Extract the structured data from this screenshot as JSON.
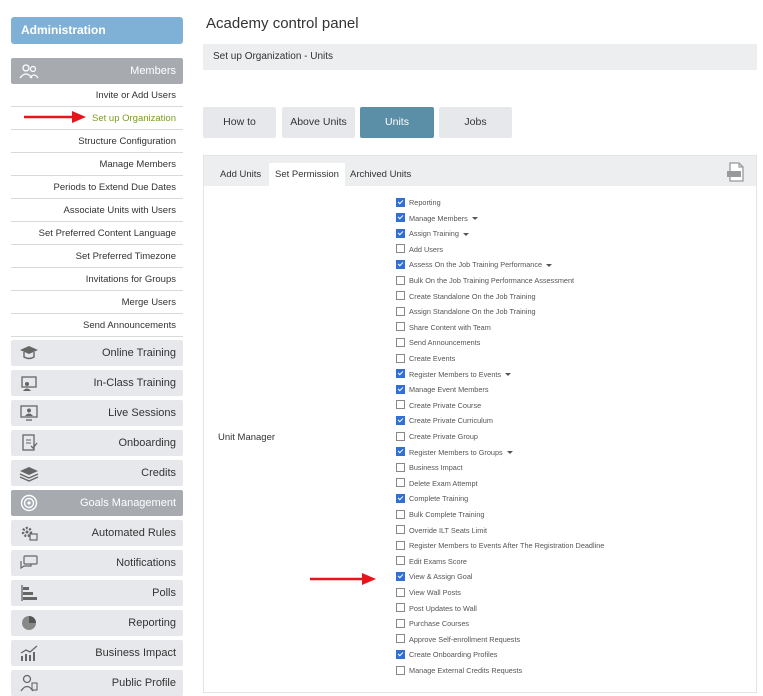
{
  "sidebar": {
    "header": "Administration",
    "members": {
      "label": "Members",
      "items": [
        "Invite or Add Users",
        "Set up Organization",
        "Structure Configuration",
        "Manage Members",
        "Periods to Extend Due Dates",
        "Associate Units with Users",
        "Set Preferred Content Language",
        "Set Preferred Timezone",
        "Invitations for Groups",
        "Merge Users",
        "Send Announcements"
      ]
    },
    "categories": [
      {
        "label": "Online Training",
        "icon": "graduation-cap-icon"
      },
      {
        "label": "In-Class Training",
        "icon": "classroom-icon"
      },
      {
        "label": "Live Sessions",
        "icon": "monitor-user-icon"
      },
      {
        "label": "Onboarding",
        "icon": "checklist-icon"
      },
      {
        "label": "Credits",
        "icon": "layers-icon"
      },
      {
        "label": "Goals Management",
        "icon": "target-icon"
      },
      {
        "label": "Automated Rules",
        "icon": "gear-calendar-icon"
      },
      {
        "label": "Notifications",
        "icon": "chat-bubbles-icon"
      },
      {
        "label": "Polls",
        "icon": "bar-list-icon"
      },
      {
        "label": "Reporting",
        "icon": "pie-chart-icon"
      },
      {
        "label": "Business Impact",
        "icon": "trend-chart-icon"
      },
      {
        "label": "Public Profile",
        "icon": "user-doc-icon"
      }
    ]
  },
  "main": {
    "title": "Academy control panel",
    "breadcrumb": "Set up Organization - Units",
    "tabs": [
      "How to",
      "Above Units",
      "Units",
      "Jobs"
    ],
    "active_tab": "Units",
    "panel_tabs": [
      "Add Units",
      "Set Permission",
      "Archived Units"
    ],
    "active_panel_tab": "Set Permission",
    "row_label": "Unit Manager",
    "permissions": [
      {
        "label": "Reporting",
        "checked": true,
        "dropdown": false
      },
      {
        "label": "Manage Members",
        "checked": true,
        "dropdown": true
      },
      {
        "label": "Assign Training",
        "checked": true,
        "dropdown": true
      },
      {
        "label": "Add Users",
        "checked": false,
        "dropdown": false
      },
      {
        "label": "Assess On the Job Training Performance",
        "checked": true,
        "dropdown": true
      },
      {
        "label": "Bulk On the Job Training Performance Assessment",
        "checked": false,
        "dropdown": false
      },
      {
        "label": "Create Standalone On the Job Training",
        "checked": false,
        "dropdown": false
      },
      {
        "label": "Assign Standalone On the Job Training",
        "checked": false,
        "dropdown": false
      },
      {
        "label": "Share Content with Team",
        "checked": false,
        "dropdown": false
      },
      {
        "label": "Send Announcements",
        "checked": false,
        "dropdown": false
      },
      {
        "label": "Create Events",
        "checked": false,
        "dropdown": false
      },
      {
        "label": "Register Members to Events",
        "checked": true,
        "dropdown": true
      },
      {
        "label": "Manage Event Members",
        "checked": true,
        "dropdown": false
      },
      {
        "label": "Create Private Course",
        "checked": false,
        "dropdown": false
      },
      {
        "label": "Create Private Curriculum",
        "checked": true,
        "dropdown": false
      },
      {
        "label": "Create Private Group",
        "checked": false,
        "dropdown": false
      },
      {
        "label": "Register Members to Groups",
        "checked": true,
        "dropdown": true
      },
      {
        "label": "Business Impact",
        "checked": false,
        "dropdown": false
      },
      {
        "label": "Delete Exam Attempt",
        "checked": false,
        "dropdown": false
      },
      {
        "label": "Complete Training",
        "checked": true,
        "dropdown": false
      },
      {
        "label": "Bulk Complete Training",
        "checked": false,
        "dropdown": false
      },
      {
        "label": "Override ILT Seats Limit",
        "checked": false,
        "dropdown": false
      },
      {
        "label": "Register Members to Events After The Registration Deadline",
        "checked": false,
        "dropdown": false
      },
      {
        "label": "Edit Exams Score",
        "checked": false,
        "dropdown": false
      },
      {
        "label": "View & Assign Goal",
        "checked": true,
        "dropdown": false
      },
      {
        "label": "View Wall Posts",
        "checked": false,
        "dropdown": false
      },
      {
        "label": "Post Updates to Wall",
        "checked": false,
        "dropdown": false
      },
      {
        "label": "Purchase Courses",
        "checked": false,
        "dropdown": false
      },
      {
        "label": "Approve Self-enrollment Requests",
        "checked": false,
        "dropdown": false
      },
      {
        "label": "Create Onboarding Profiles",
        "checked": true,
        "dropdown": false
      },
      {
        "label": "Manage External Credits Requests",
        "checked": false,
        "dropdown": false
      }
    ]
  },
  "colors": {
    "admin_header": "#7fb1d6",
    "active_tab": "#5b8fa8",
    "active_link": "#7a9c1f",
    "annotation_arrow": "#e8141b",
    "checkbox": "#2f6fd6"
  }
}
